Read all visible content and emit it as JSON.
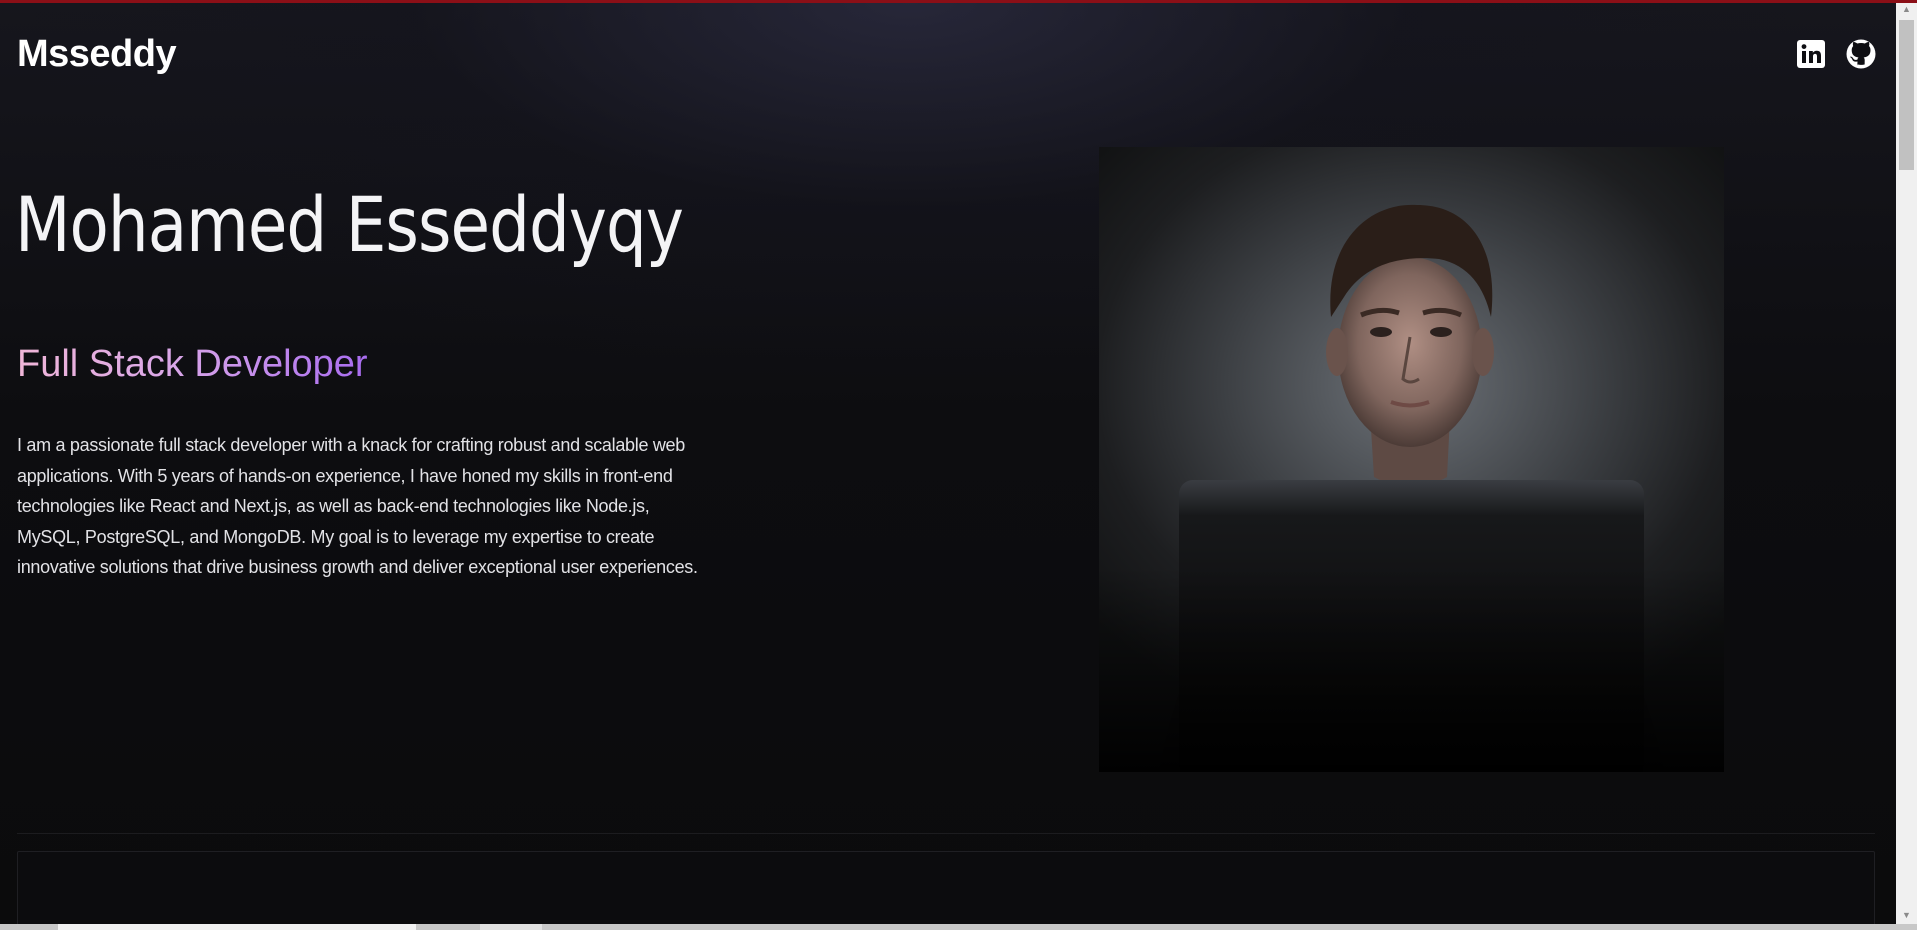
{
  "header": {
    "brand": "Msseddy",
    "social": [
      {
        "name": "LinkedIn",
        "icon": "linkedin-icon"
      },
      {
        "name": "GitHub",
        "icon": "github-icon"
      }
    ]
  },
  "hero": {
    "name": "Mohamed Esseddyqy",
    "role": "Full Stack Developer",
    "description": "I am a passionate full stack developer with a knack for crafting robust and scalable web applications. With 5 years of hands-on experience, I have honed my skills in front-end technologies like React and Next.js, as well as back-end technologies like Node.js, MySQL, PostgreSQL, and MongoDB. My goal is to leverage my expertise to create innovative solutions that drive business growth and deliver exceptional user experiences."
  },
  "colors": {
    "background": "#0b0b0c",
    "accent_top": "#8b0f17",
    "role_gradient_start": "#f0b6d8",
    "role_gradient_end": "#a86cf0",
    "text": "#ffffff"
  }
}
